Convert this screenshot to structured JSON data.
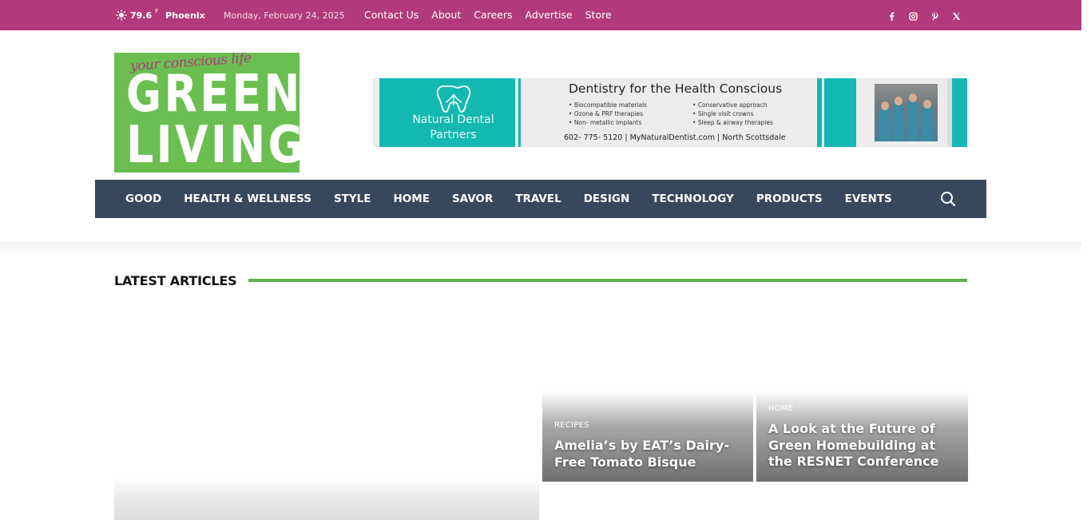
{
  "topbar": {
    "temperature": "79.6",
    "unit": "F",
    "city": "Phoenix",
    "date": "Monday, February 24, 2025",
    "links": [
      "Contact Us",
      "About",
      "Careers",
      "Advertise",
      "Store"
    ],
    "socials": [
      "facebook-icon",
      "instagram-icon",
      "pinterest-icon",
      "x-icon"
    ],
    "color": "#b23a7c"
  },
  "logo": {
    "tagline": "your conscious life",
    "word1": "GREEN",
    "word2": "LIVING",
    "color": "#6abf50"
  },
  "ad": {
    "brand_line1": "Natural Dental",
    "brand_line2": "Partners",
    "headline": "Dentistry for the Health Conscious",
    "bullets_left": [
      "Biocompatible materials",
      "Ozone & PRF therapies",
      "Non- metallic implants"
    ],
    "bullets_right": [
      "Conservative approach",
      "Single visit crowns",
      "Sleep & airway therapies"
    ],
    "contact": "602- 775- 5120 | MyNaturalDentist.com | North Scottsdale",
    "accent": "#13b8b1"
  },
  "nav": {
    "items": [
      "GOOD",
      "HEALTH & WELLNESS",
      "STYLE",
      "HOME",
      "SAVOR",
      "TRAVEL",
      "DESIGN",
      "TECHNOLOGY",
      "PRODUCTS",
      "EVENTS"
    ],
    "color": "#37485c"
  },
  "latest": {
    "title": "LATEST ARTICLES",
    "accent": "#5db24a",
    "articles": [
      {
        "category": "RECIPES",
        "title": "Amelia’s by EAT’s Dairy-Free Tomato Bisque"
      },
      {
        "category": "HOME",
        "title": "A Look at the Future of Green Homebuilding at the RESNET Conference"
      }
    ]
  }
}
